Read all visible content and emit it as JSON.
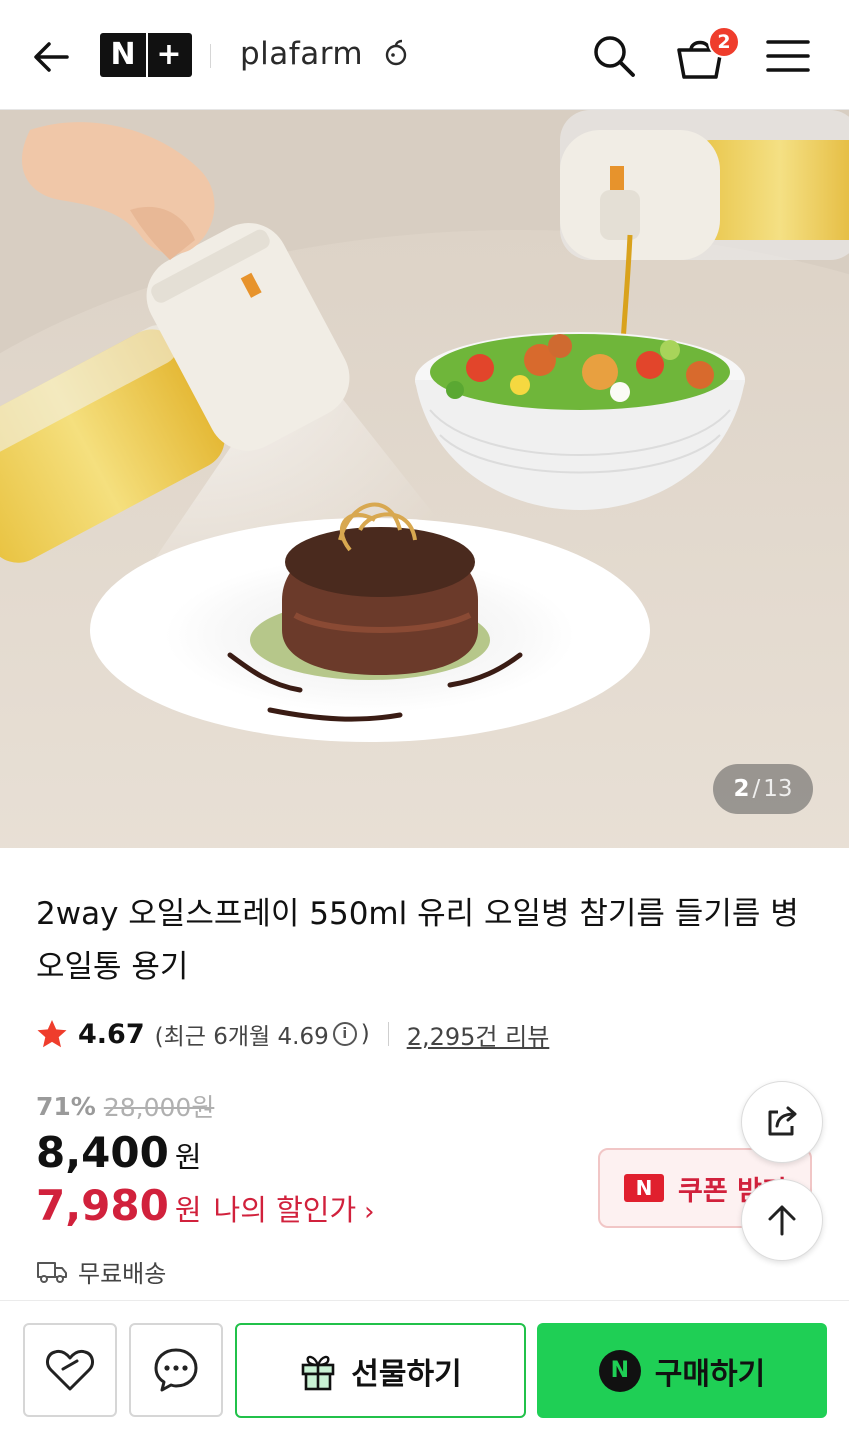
{
  "header": {
    "np_logo_left": "N",
    "np_logo_right": "+",
    "brand": "plafarm",
    "cart_count": "2"
  },
  "gallery": {
    "current": "2",
    "separator": "/",
    "total": "13"
  },
  "product": {
    "title": "2way 오일스프레이 550ml 유리 오일병 참기름 들기름 병 오일통 용기",
    "rating": "4.67",
    "recent_rating_prefix": "(최근 6개월 4.69",
    "recent_rating_suffix": ")",
    "info_glyph": "i",
    "review_count": "2,295건 리뷰"
  },
  "pricing": {
    "discount_pct": "71%",
    "original_price": "28,000원",
    "price": "8,400",
    "price_unit": "원",
    "my_price": "7,980",
    "my_price_unit": "원",
    "my_price_label": "나의 할인가",
    "chevron": "›"
  },
  "coupon": {
    "badge": "N",
    "label": "쿠폰 받기"
  },
  "shipping": {
    "label": "무료배송"
  },
  "bottom_bar": {
    "gift_label": "선물하기",
    "buy_badge": "N",
    "buy_label": "구매하기"
  },
  "colors": {
    "accent_red": "#d1213c",
    "naver_green": "#1fcf55",
    "badge_red": "#ef3d2c",
    "star": "#ef3d2c"
  },
  "icons": [
    "back-arrow-icon",
    "search-icon",
    "cart-icon",
    "menu-icon",
    "star-icon",
    "info-icon",
    "share-icon",
    "arrow-up-icon",
    "truck-icon",
    "heart-icon",
    "chat-icon",
    "gift-icon"
  ]
}
